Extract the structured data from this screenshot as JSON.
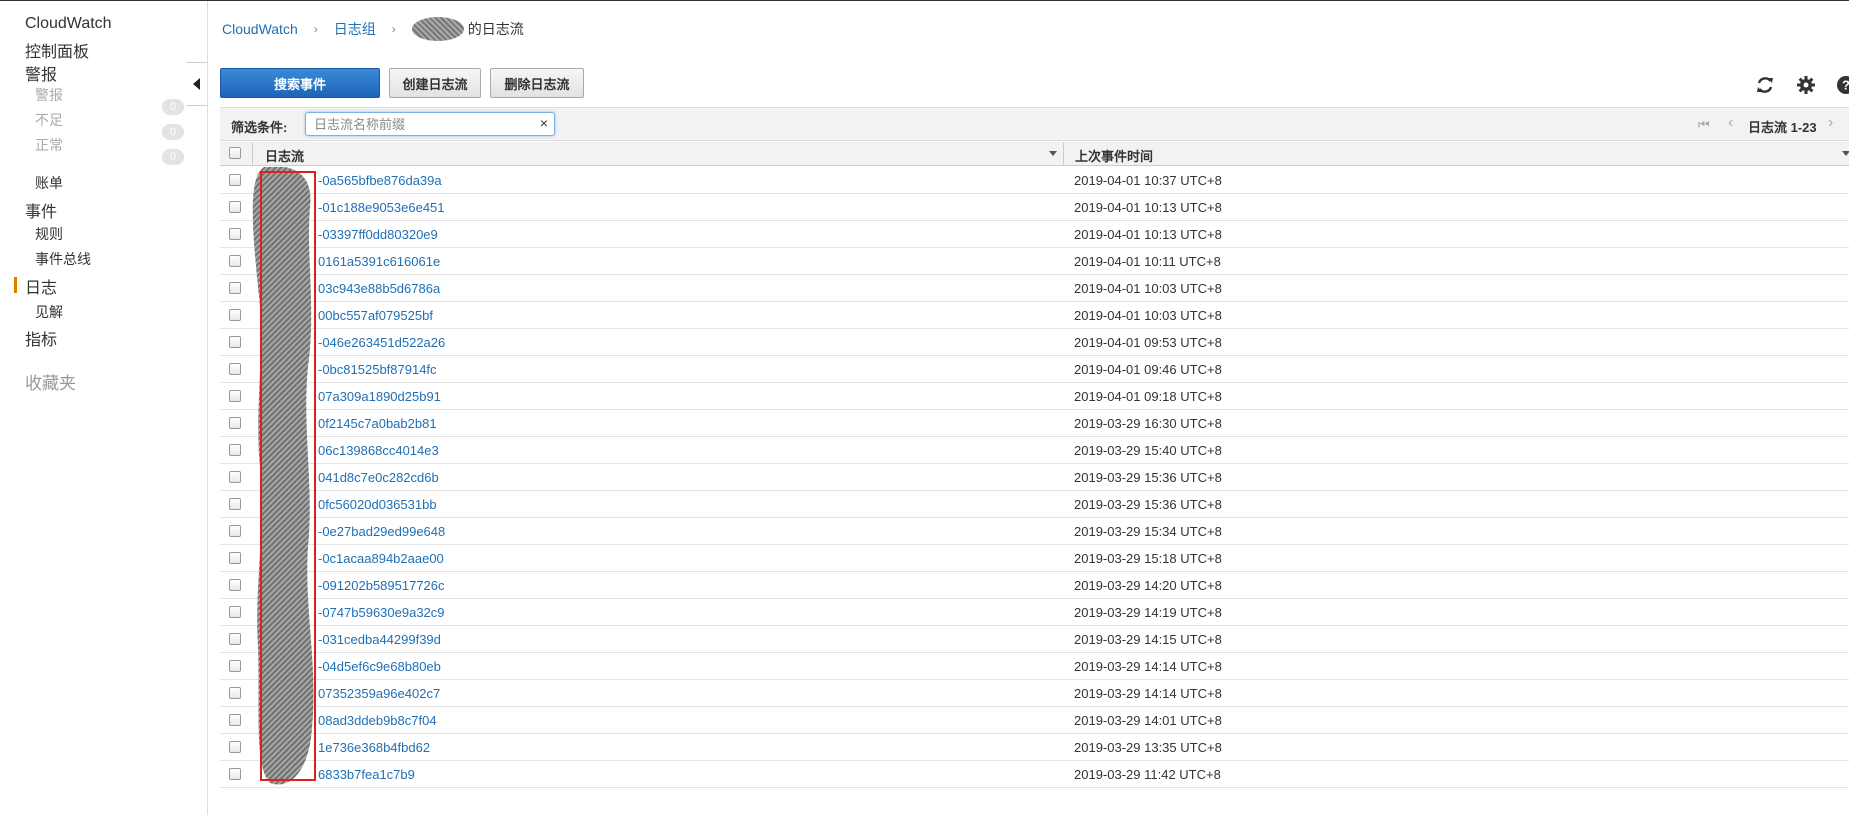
{
  "sidebar": {
    "items": [
      {
        "label": "CloudWatch"
      },
      {
        "label": "控制面板"
      },
      {
        "label": "警报"
      },
      {
        "label": "警报",
        "badge": "0"
      },
      {
        "label": "不足",
        "badge": "0"
      },
      {
        "label": "正常",
        "badge": "0"
      },
      {
        "label": "账单"
      },
      {
        "label": "事件"
      },
      {
        "label": "规则"
      },
      {
        "label": "事件总线"
      },
      {
        "label": "日志"
      },
      {
        "label": "见解"
      },
      {
        "label": "指标"
      }
    ],
    "favorites_label": "收藏夹"
  },
  "breadcrumb": {
    "root": "CloudWatch",
    "group": "日志组",
    "current": "的日志流"
  },
  "toolbar": {
    "search_label": "搜索事件",
    "create_label": "创建日志流",
    "delete_label": "删除日志流"
  },
  "filter": {
    "label": "筛选条件:",
    "placeholder": "日志流名称前缀",
    "clear": "×",
    "pager": "日志流 1-23"
  },
  "table": {
    "columns": [
      "日志流",
      "上次事件时间"
    ],
    "rows": [
      {
        "stream": "-0a565bfbe876da39a",
        "time": "2019-04-01 10:37 UTC+8"
      },
      {
        "stream": "-01c188e9053e6e451",
        "time": "2019-04-01 10:13 UTC+8"
      },
      {
        "stream": "-03397ff0dd80320e9",
        "time": "2019-04-01 10:13 UTC+8"
      },
      {
        "stream": "0161a5391c616061e",
        "time": "2019-04-01 10:11 UTC+8"
      },
      {
        "stream": "03c943e88b5d6786a",
        "time": "2019-04-01 10:03 UTC+8"
      },
      {
        "stream": "00bc557af079525bf",
        "time": "2019-04-01 10:03 UTC+8"
      },
      {
        "stream": "-046e263451d522a26",
        "time": "2019-04-01 09:53 UTC+8"
      },
      {
        "stream": "-0bc81525bf87914fc",
        "time": "2019-04-01 09:46 UTC+8"
      },
      {
        "stream": "07a309a1890d25b91",
        "time": "2019-04-01 09:18 UTC+8"
      },
      {
        "stream": "0f2145c7a0bab2b81",
        "time": "2019-03-29 16:30 UTC+8"
      },
      {
        "stream": "06c139868cc4014e3",
        "time": "2019-03-29 15:40 UTC+8"
      },
      {
        "stream": "041d8c7e0c282cd6b",
        "time": "2019-03-29 15:36 UTC+8"
      },
      {
        "stream": "0fc56020d036531bb",
        "time": "2019-03-29 15:36 UTC+8"
      },
      {
        "stream": "-0e27bad29ed99e648",
        "time": "2019-03-29 15:34 UTC+8"
      },
      {
        "stream": "-0c1acaa894b2aae00",
        "time": "2019-03-29 15:18 UTC+8"
      },
      {
        "stream": "-091202b589517726c",
        "time": "2019-03-29 14:20 UTC+8"
      },
      {
        "stream": "-0747b59630e9a32c9",
        "time": "2019-03-29 14:19 UTC+8"
      },
      {
        "stream": "-031cedba44299f39d",
        "time": "2019-03-29 14:15 UTC+8"
      },
      {
        "stream": "-04d5ef6c9e68b80eb",
        "time": "2019-03-29 14:14 UTC+8"
      },
      {
        "stream": "07352359a96e402c7",
        "time": "2019-03-29 14:14 UTC+8"
      },
      {
        "stream": "08ad3ddeb9b8c7f04",
        "time": "2019-03-29 14:01 UTC+8"
      },
      {
        "stream": "1e736e368b4fbd62",
        "time": "2019-03-29 13:35 UTC+8"
      },
      {
        "stream": "6833b7fea1c7b9",
        "time": "2019-03-29 11:42 UTC+8"
      }
    ]
  },
  "icons": {
    "refresh": "refresh-icon",
    "settings": "gear-icon",
    "help": "help-icon"
  },
  "colors": {
    "primary": "#1f6fb5",
    "active_nav": "#e07b00",
    "redaction_border": "#e02020"
  }
}
